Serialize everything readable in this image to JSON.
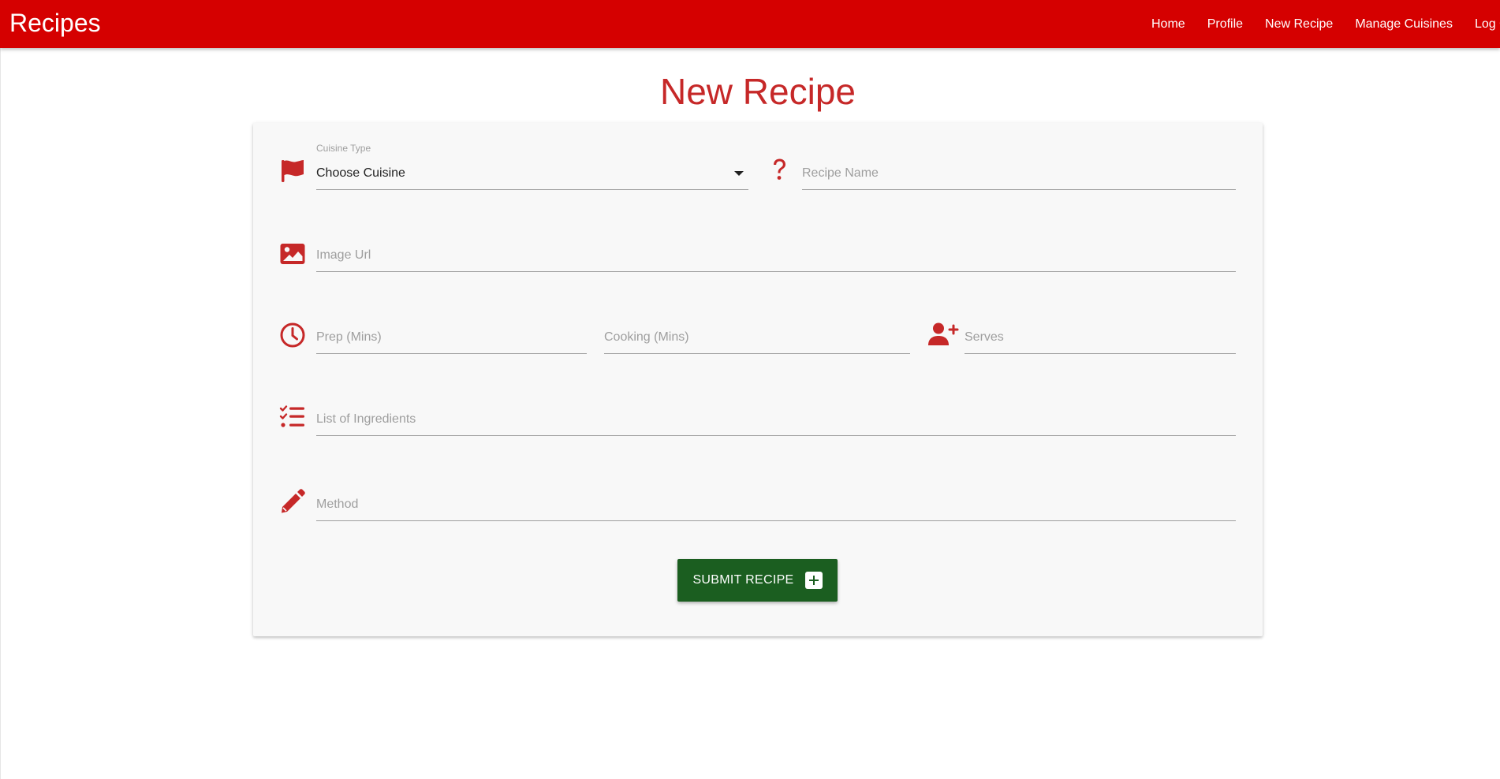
{
  "navbar": {
    "brand": "Recipes",
    "links": [
      "Home",
      "Profile",
      "New Recipe",
      "Manage Cuisines",
      "Log Out"
    ]
  },
  "page_title": "New Recipe",
  "form": {
    "cuisine": {
      "label": "Cuisine Type",
      "selected": "Choose Cuisine",
      "icon": "flag-icon"
    },
    "recipe_name": {
      "placeholder": "Recipe Name",
      "icon": "question-icon"
    },
    "image_url": {
      "placeholder": "Image Url",
      "icon": "image-icon"
    },
    "prep": {
      "placeholder": "Prep (Mins)",
      "icon": "clock-icon"
    },
    "cooking": {
      "placeholder": "Cooking (Mins)"
    },
    "serves": {
      "placeholder": "Serves",
      "icon": "user-plus-icon"
    },
    "ingredients": {
      "placeholder": "List of Ingredients",
      "icon": "checklist-icon"
    },
    "method": {
      "placeholder": "Method",
      "icon": "pencil-icon"
    },
    "submit_label": "SUBMIT RECIPE"
  },
  "colors": {
    "brand_red": "#d50000",
    "accent_red": "#c62828",
    "submit_green": "#1b5e20"
  }
}
